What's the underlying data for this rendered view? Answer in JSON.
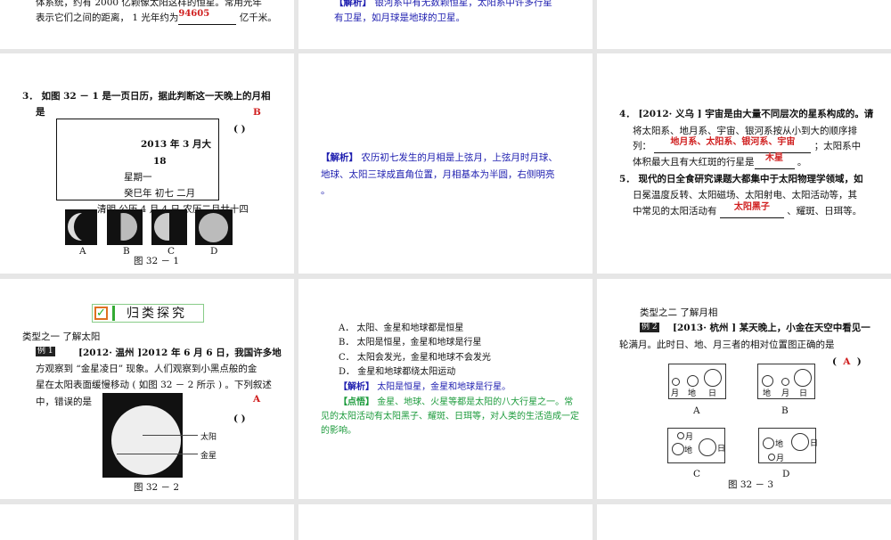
{
  "slide1": {
    "line1": "体系统，约有 2000 亿颗像太阳这样的恒星。常用光年",
    "line2_pre": "表示它们之间的距离，  1 光年约为",
    "answer": "94605",
    "line2_post": "亿千米。"
  },
  "slide2": {
    "label": "【解析】",
    "line1": "银河系中有无数颗恒星，太阳系中许多行星",
    "line2": "有卫星，如月球是地球的卫星。"
  },
  "slide4": {
    "q_line1": "3． 如图 32 － 1 是一页日历，据此判断这一天晚上的月相",
    "q_line2": "是",
    "answer": "B",
    "bracket": "(          )",
    "calendar": [
      "2013 年 3 月大",
      "18",
      "星期一",
      "癸巳年  初七  二月",
      "清明  公历 4 月 4 日  农历二月廿十四"
    ],
    "options": [
      "A",
      "B",
      "C",
      "D"
    ],
    "caption": "图 32 － 1"
  },
  "slide5": {
    "label": "【解析】",
    "line1": "农历初七发生的月相是上弦月，上弦月时月球、",
    "line2": "地球、太阳三球成直角位置，月相基本为半圆，右侧明亮",
    "line3": "。"
  },
  "slide6": {
    "q4_l1": "4． [2012· 义乌 ] 宇宙是由大量不同层次的星系构成的。请",
    "q4_l2": "将太阳系、地月系、宇宙、银河系按从小到大的顺序排",
    "q4_l3_pre": "列：",
    "q4_ans1": "地月系、太阳系、银河系、宇宙",
    "q4_l3_post": "；太阳系中",
    "q4_l4_pre": "体积最大且有大红斑的行星是",
    "q4_ans2": "木星",
    "q4_l4_post": "。",
    "q5_l1": "5． 现代的日全食研究课题大都集中于太阳物理学领域，如",
    "q5_l2": "日冕温度反转、太阳磁场、太阳射电、太阳活动等，其",
    "q5_l3_pre": "中常见的太阳活动有",
    "q5_ans": "太阳黑子",
    "q5_l3_post": "、耀斑、日珥等。"
  },
  "slide7": {
    "banner": "归类探究",
    "type": "类型之一    了解太阳",
    "example": "例 1",
    "l1": "[2012· 温州 ]2012 年 6 月 6 日，我国许多地",
    "l2": "方观察到 “金星凌日” 现象。人们观察到小黑点般的金",
    "l3": "星在太阳表面缓慢移动 ( 如图 32 － 2 所示 ) 。下列叙述",
    "l4": "中，错误的是",
    "answer": "A",
    "bracket": "(          )",
    "label_sun": "太阳",
    "label_venus": "金星",
    "caption": "图 32 － 2"
  },
  "slide8": {
    "options": [
      "A． 太阳、金星和地球都是恒星",
      "B． 太阳是恒星，金星和地球是行星",
      "C． 太阳会发光，金星和地球不会发光",
      "D． 金星和地球都绕太阳运动"
    ],
    "jiexi_label": "【解析】",
    "jiexi": "太阳是恒星，金星和地球是行星。",
    "dianwu_label": "【点悟】",
    "dianwu1": "金星、地球、火星等都是太阳的八大行星之一。常",
    "dianwu2": "见的太阳活动有太阳黑子、耀斑、日珥等，对人类的生活造成一定",
    "dianwu3": "的影响。"
  },
  "slide9": {
    "type": "类型之二    了解月相",
    "example": "例 2",
    "l1": "[2013· 杭州 ] 某天晚上，小金在天空中看见一",
    "l2": "轮满月。此时日、地、月三者的相对位置图正确的是",
    "bracket_open": "(",
    "answer": "A",
    "bracket_close": ")",
    "moon": "月",
    "earth": "地",
    "sun": "日",
    "options": [
      "A",
      "B",
      "C",
      "D"
    ],
    "caption": "图 32 － 3"
  }
}
